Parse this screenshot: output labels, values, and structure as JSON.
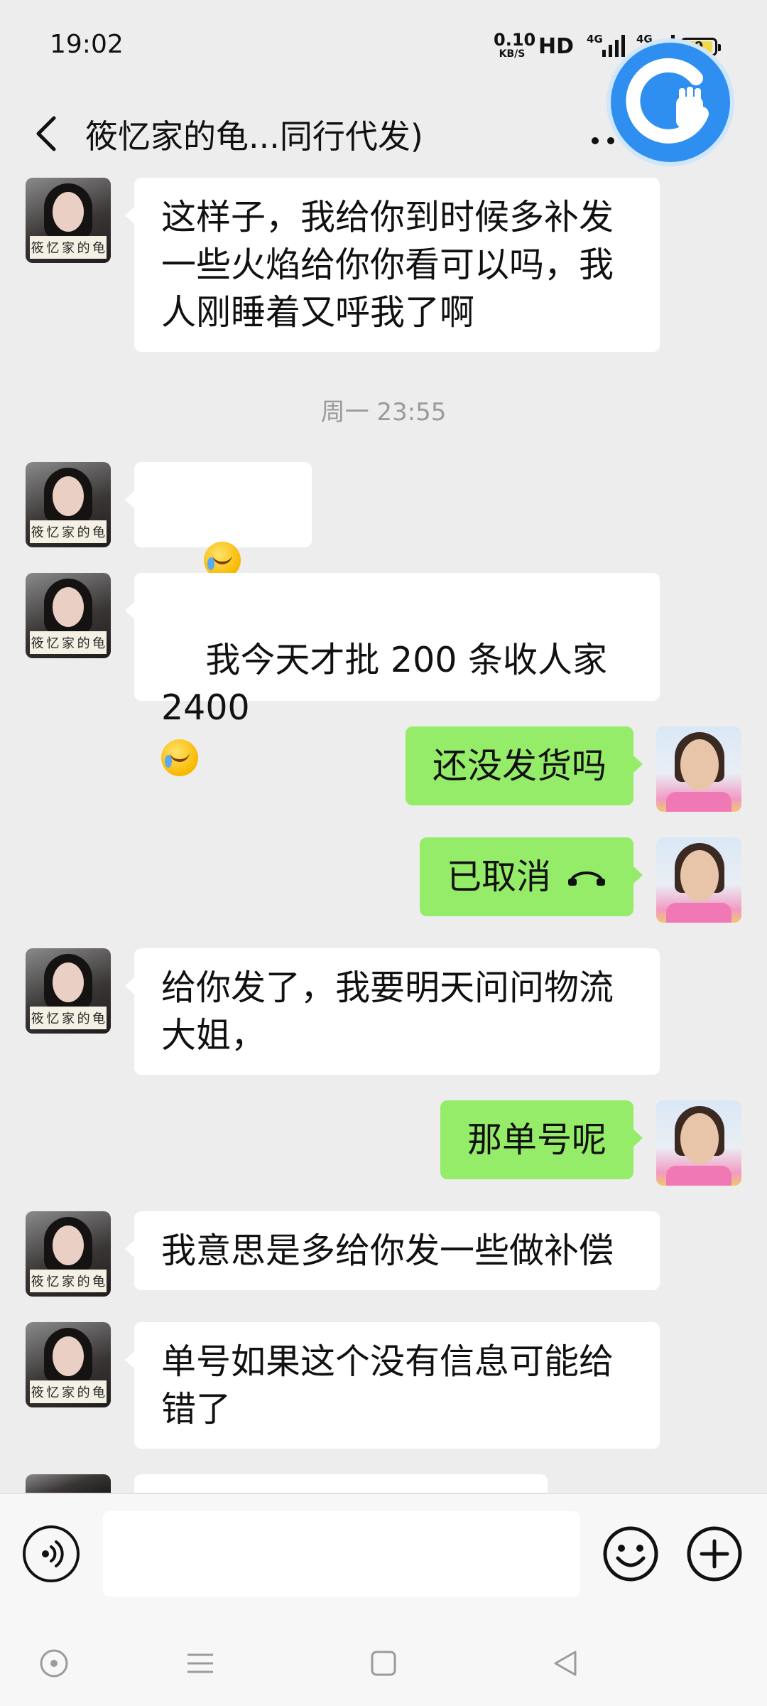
{
  "status_bar": {
    "time": "19:02",
    "net_speed_value": "0.10",
    "net_speed_unit": "KB/S",
    "hd_label": "HD",
    "signal_1_label": "4G",
    "signal_2_label": "4G",
    "battery_level": "9"
  },
  "header": {
    "title": "筱忆家的龟...同行代发)"
  },
  "avatars": {
    "contact_tag_chars": [
      "筱",
      "忆",
      "家",
      "的",
      "龟"
    ]
  },
  "messages": [
    {
      "side": "left",
      "text": "这样子，我给你到时候多补发\n一些火焰给你你看可以吗，我\n人刚睡着又呼我了啊"
    },
    {
      "side": "left",
      "text": ""
    },
    {
      "side": "left",
      "text": "我今天才批 200 条收人家 2400\n"
    },
    {
      "side": "right",
      "text": "还没发货吗"
    },
    {
      "side": "right",
      "text": "已取消"
    },
    {
      "side": "left",
      "text": "给你发了，我要明天问问物流\n大姐，"
    },
    {
      "side": "right",
      "text": "那单号呢"
    },
    {
      "side": "left",
      "text": "我意思是多给你发一些做补偿"
    },
    {
      "side": "left",
      "text": "单号如果这个没有信息可能给\n错了"
    }
  ],
  "timestamp": "周一 23:55",
  "input": {
    "placeholder": ""
  }
}
